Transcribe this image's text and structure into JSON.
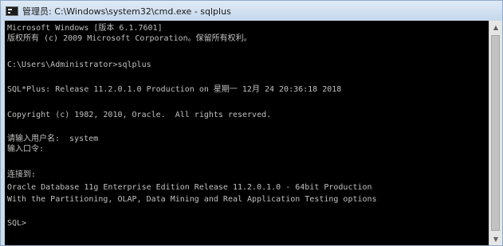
{
  "window": {
    "title": "管理员: C:\\Windows\\system32\\cmd.exe - sqlplus",
    "icon": "cmd-icon"
  },
  "console": {
    "lines": [
      "Microsoft Windows [版本 6.1.7601]",
      "版权所有 (c) 2009 Microsoft Corporation。保留所有权利。",
      "C:\\Users\\Administrator>sqlplus",
      "SQL*Plus: Release 11.2.0.1.0 Production on 星期一 12月 24 20:36:18 2018",
      "Copyright (c) 1982, 2010, Oracle.  All rights reserved.",
      "请输入用户名:  system",
      "输入口令:",
      "连接到:",
      "Oracle Database 11g Enterprise Edition Release 11.2.0.1.0 - 64bit Production",
      "With the Partitioning, OLAP, Data Mining and Real Application Testing options",
      "SQL>"
    ]
  },
  "scrollbar": {
    "up_icon": "arrow-up-icon",
    "down_icon": "arrow-down-icon",
    "up_glyph": "▲",
    "down_glyph": "▼"
  },
  "colors": {
    "console_background": "#000000",
    "console_text": "#c0c0c0",
    "titlebar": "#d3e2f2"
  }
}
